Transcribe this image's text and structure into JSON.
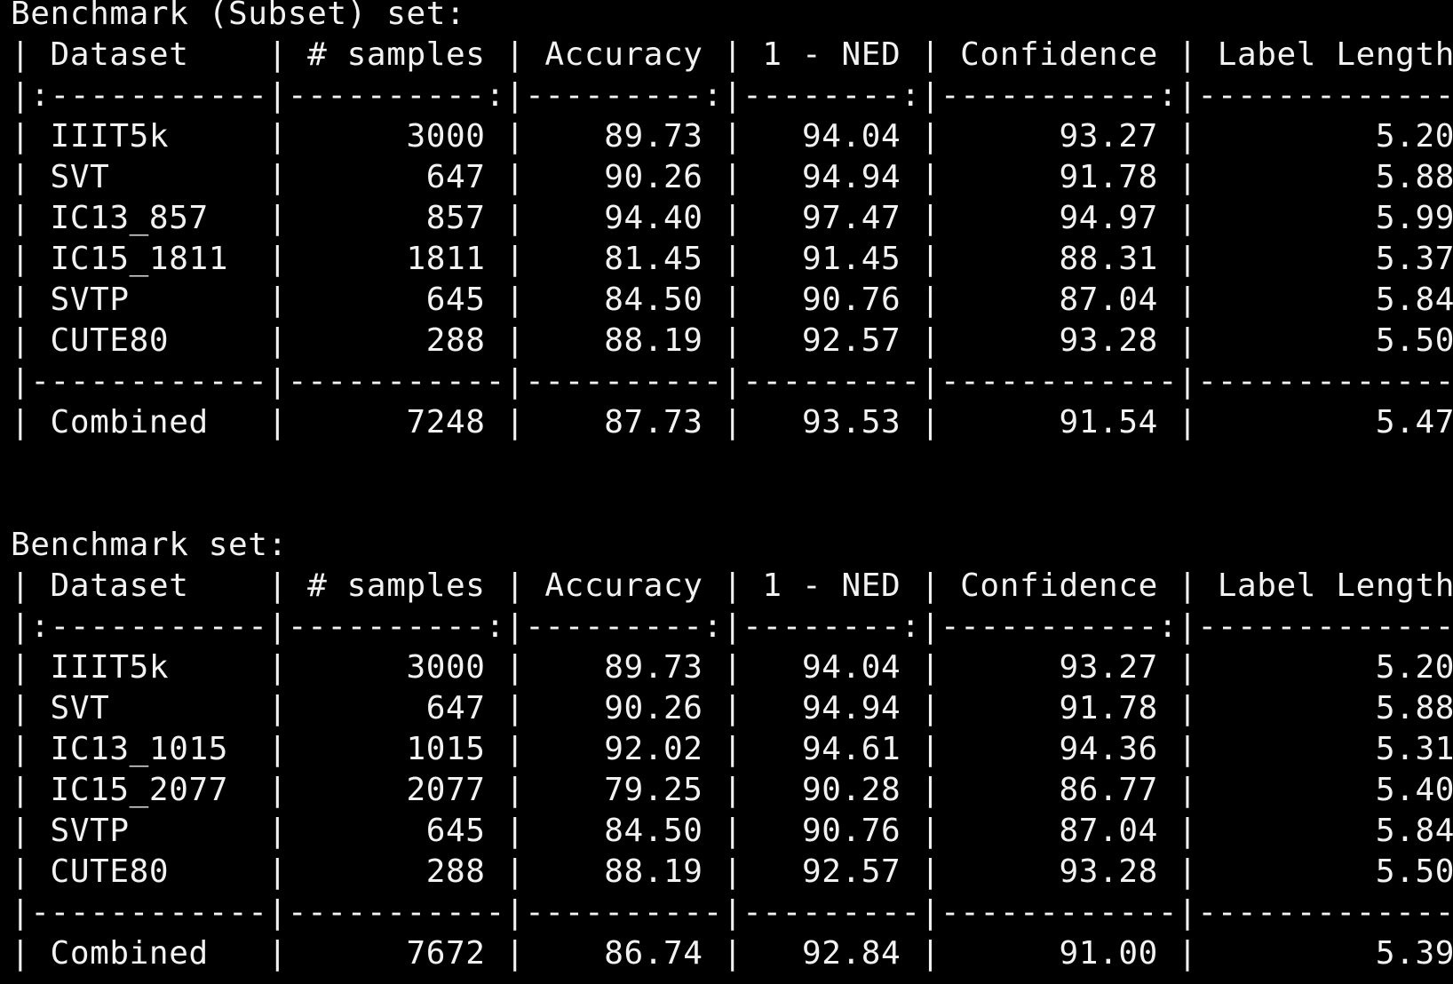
{
  "terminal": {
    "text_color": "#f2f2f2",
    "background": "#000000"
  },
  "tables": [
    {
      "heading": "Benchmark (Subset) set:",
      "lines": [
        "| Dataset    | # samples | Accuracy | 1 - NED | Confidence | Label Length |",
        "|:-----------|----------:|---------:|--------:|-----------:|-------------:|",
        "| IIIT5k     |      3000 |    89.73 |   94.04 |      93.27 |         5.20 |",
        "| SVT        |       647 |    90.26 |   94.94 |      91.78 |         5.88 |",
        "| IC13_857   |       857 |    94.40 |   97.47 |      94.97 |         5.99 |",
        "| IC15_1811  |      1811 |    81.45 |   91.45 |      88.31 |         5.37 |",
        "| SVTP       |       645 |    84.50 |   90.76 |      87.04 |         5.84 |",
        "| CUTE80     |       288 |    88.19 |   92.57 |      93.28 |         5.50 |",
        "|------------|-----------|----------|---------|------------|--------------|",
        "| Combined   |      7248 |    87.73 |   93.53 |      91.54 |         5.47 |"
      ]
    },
    {
      "heading": "Benchmark set:",
      "lines": [
        "| Dataset    | # samples | Accuracy | 1 - NED | Confidence | Label Length |",
        "|:-----------|----------:|---------:|--------:|-----------:|-------------:|",
        "| IIIT5k     |      3000 |    89.73 |   94.04 |      93.27 |         5.20 |",
        "| SVT        |       647 |    90.26 |   94.94 |      91.78 |         5.88 |",
        "| IC13_1015  |      1015 |    92.02 |   94.61 |      94.36 |         5.31 |",
        "| IC15_2077  |      2077 |    79.25 |   90.28 |      86.77 |         5.40 |",
        "| SVTP       |       645 |    84.50 |   90.76 |      87.04 |         5.84 |",
        "| CUTE80     |       288 |    88.19 |   92.57 |      93.28 |         5.50 |",
        "|------------|-----------|----------|---------|------------|--------------|",
        "| Combined   |      7672 |    86.74 |   92.84 |      91.00 |         5.39 |"
      ]
    }
  ]
}
